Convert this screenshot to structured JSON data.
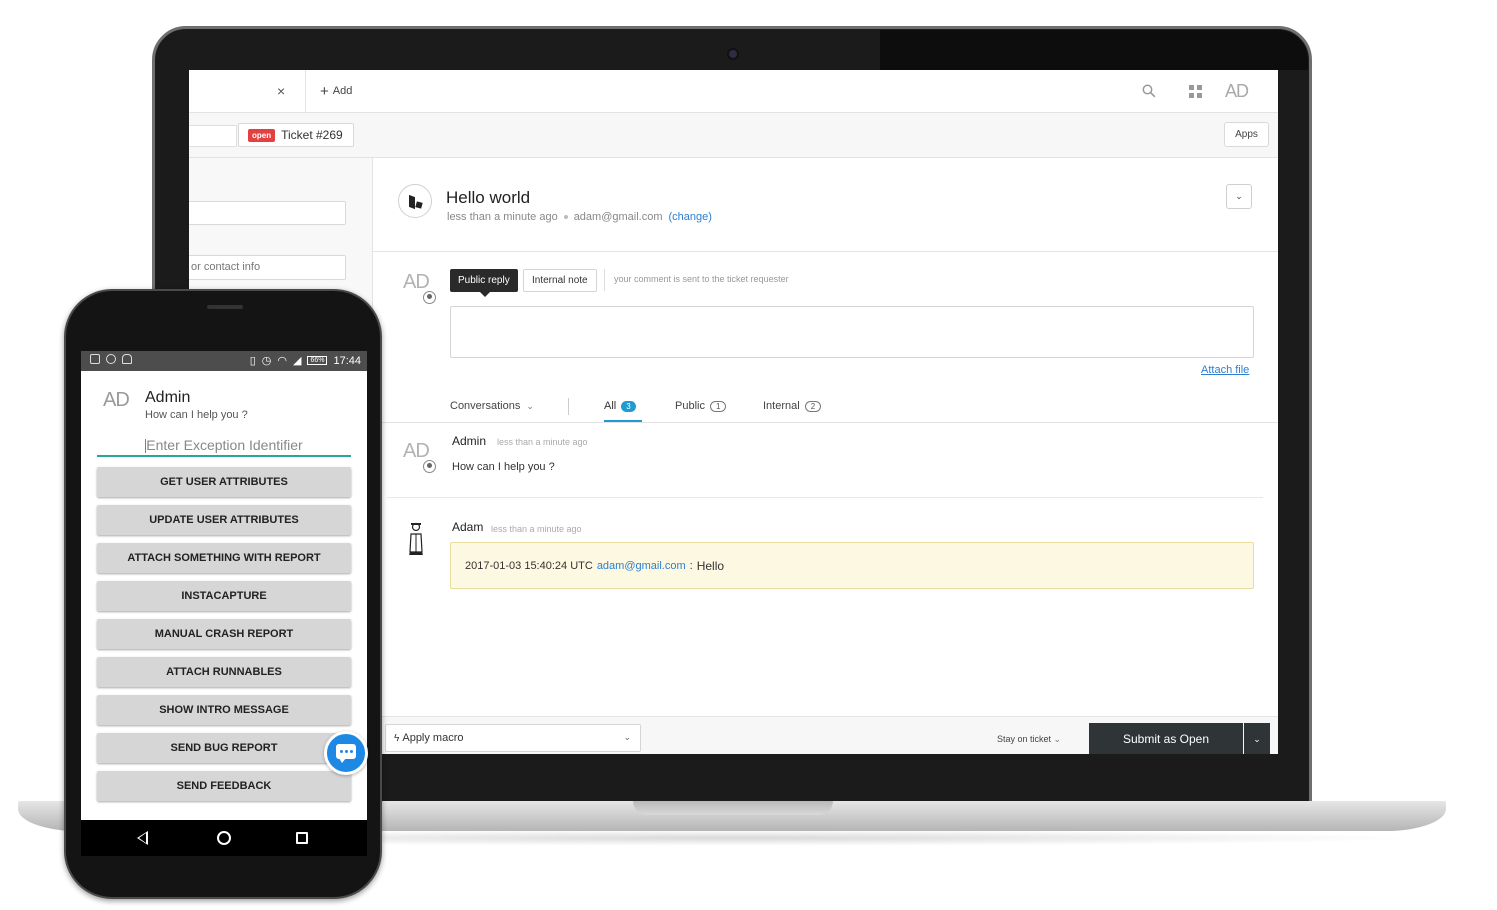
{
  "desktop": {
    "topbar": {
      "close_glyph": "×",
      "add_label": "Add",
      "avatar_initials": "AD"
    },
    "subbar": {
      "status_badge": "open",
      "ticket_label": "Ticket #269",
      "apps_label": "Apps"
    },
    "left": {
      "contact_placeholder": "or contact info"
    },
    "ticket": {
      "title": "Hello world",
      "time": "less than a minute ago",
      "email": "adam@gmail.com",
      "change_label": "(change)",
      "dropdown_glyph": "⌄"
    },
    "composer": {
      "avatar_initials": "AD",
      "public_reply_label": "Public reply",
      "internal_note_label": "Internal note",
      "hint": "your comment is sent to the ticket requester",
      "attach_label": "Attach file"
    },
    "tabs": {
      "conversations_label": "Conversations",
      "all_label": "All",
      "all_count": "3",
      "public_label": "Public",
      "public_count": "1",
      "internal_label": "Internal",
      "internal_count": "2"
    },
    "messages": [
      {
        "avatar": "AD",
        "author": "Admin",
        "time": "less than a minute ago",
        "body": "How can I help you ?"
      },
      {
        "author": "Adam",
        "time": "less than a minute ago",
        "timestamp": "2017-01-03 15:40:24 UTC",
        "email": "adam@gmail.com",
        "separator": ":",
        "body": "Hello"
      }
    ],
    "footer": {
      "macro_label": "Apply macro",
      "stay_label": "Stay on ticket",
      "submit_prefix": "Submit as",
      "submit_status": "Open"
    }
  },
  "mobile": {
    "status_time": "17:44",
    "battery": "66%",
    "app": {
      "avatar_initials": "AD",
      "name": "Admin",
      "subtitle": "How can I help you ?",
      "input_placeholder": "Enter Exception Identifier",
      "buttons": [
        "GET USER ATTRIBUTES",
        "UPDATE USER ATTRIBUTES",
        "ATTACH SOMETHING WITH REPORT",
        "INSTACAPTURE",
        "MANUAL CRASH REPORT",
        "ATTACH RUNNABLES",
        "SHOW INTRO MESSAGE",
        "SEND BUG REPORT",
        "SEND FEEDBACK"
      ]
    }
  }
}
